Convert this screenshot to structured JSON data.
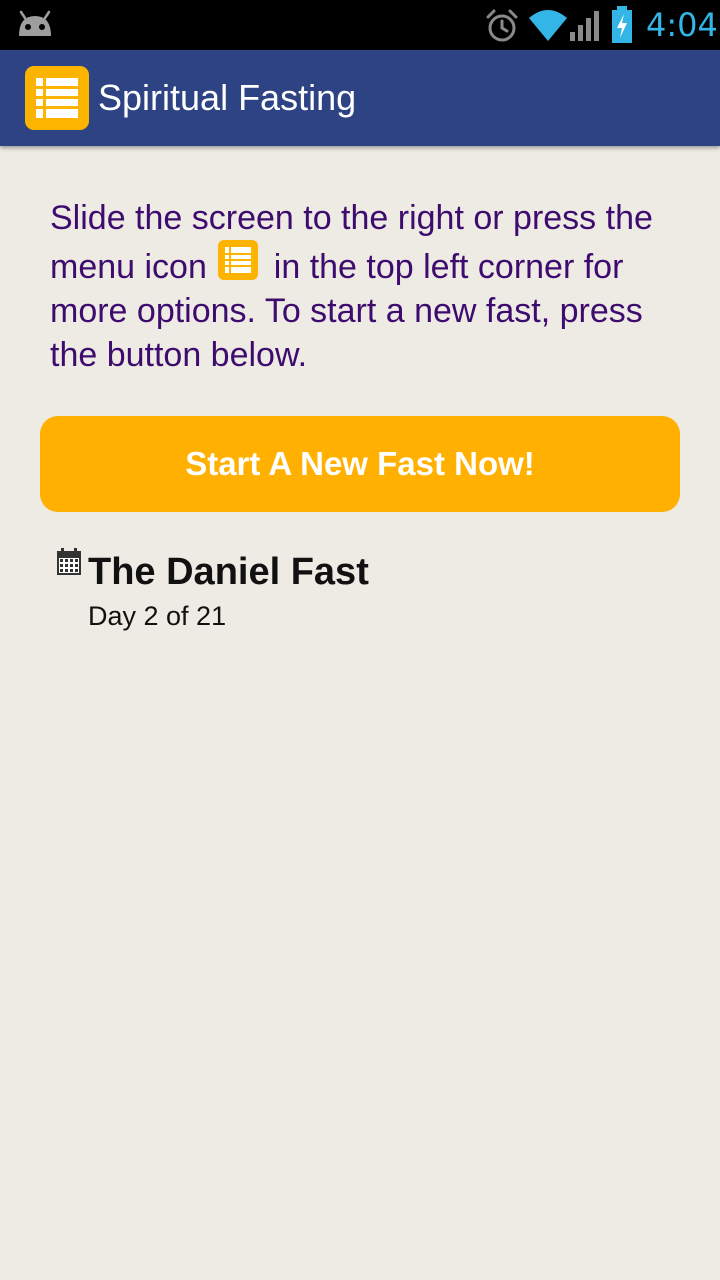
{
  "status_bar": {
    "time": "4:04",
    "icons": [
      "android-icon",
      "alarm-icon",
      "wifi-icon",
      "signal-icon",
      "battery-charging-icon"
    ]
  },
  "action_bar": {
    "icon": "list-menu-icon",
    "title": "Spiritual Fasting"
  },
  "intro": {
    "before_icon": "Slide the screen to the right or press the menu icon",
    "after_icon": "in the top left corner for more options. To start a new fast, press the button below.",
    "inline_icon": "list-menu-icon"
  },
  "start_button": {
    "label": "Start A New Fast Now!"
  },
  "fasts": [
    {
      "icon": "calendar-icon",
      "title": "The Daniel Fast",
      "progress": "Day 2 of 21"
    }
  ],
  "colors": {
    "status_bar": "#000000",
    "clock": "#33b5e5",
    "action_bar": "#2d4383",
    "accent": "#fdb400",
    "button": "#ffb000",
    "intro_text": "#3e0b6e",
    "background": "#eeebe4"
  }
}
